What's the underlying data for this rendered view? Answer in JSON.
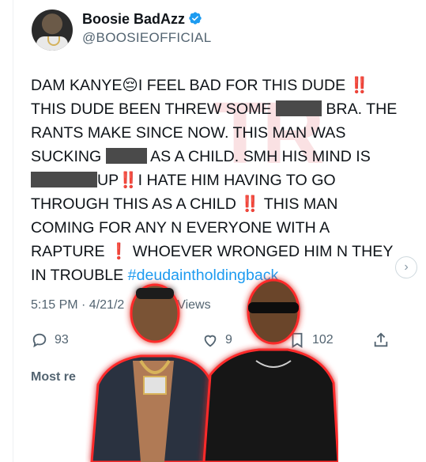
{
  "post": {
    "author_name": "Boosie BadAzz",
    "handle": "@BOOSIEOFFICIAL",
    "lines": {
      "l1a": "DAM KANYE",
      "l1b": "I FEEL BAD FOR THIS DUDE ",
      "l2a": "THIS DUDE BEEN THREW SOME ",
      "l2b": " BRA. THE",
      "l3": "RANTS MAKE SINCE NOW. THIS MAN WAS",
      "l4a": "SUCKING ",
      "l4b": " AS A CHILD. SMH HIS MIND IS",
      "l5a": "UP",
      "l5b": "I HATE HIM HAVING TO GO",
      "l6a": "THROUGH  THIS AS A CHILD ",
      "l6b": " THIS MAN",
      "l7": "COMING FOR ANY N EVERYONE WITH A",
      "l8a": "RAPTURE ",
      "l8b": "  WHOEVER WRONGED HIM N THEY",
      "l9a": "IN TROUBLE ",
      "hashtag": "#deudaintholdingback"
    },
    "emoji": {
      "pensive": "😔",
      "double_bang": "‼️",
      "single_bang": "❗"
    },
    "timestamp_visible": "5:15 PM · 4/21/2",
    "views_visible": "Views",
    "watermark": "TR"
  },
  "actions": {
    "replies": "93",
    "likes_visible": "9",
    "bookmarks": "102"
  },
  "footer": {
    "most_relevant_visible": "Most re"
  },
  "colors": {
    "accent": "#1d9bf0",
    "text": "#0f1419",
    "muted": "#536471",
    "glow": "#ff2a2a"
  },
  "icons": [
    "verified-badge-icon",
    "reply-icon",
    "like-icon",
    "bookmark-icon",
    "share-icon",
    "chevron-right-icon"
  ]
}
